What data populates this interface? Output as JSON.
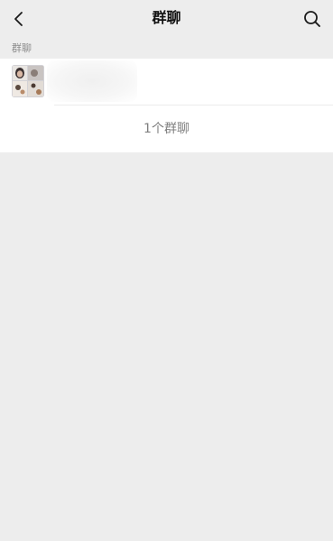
{
  "nav": {
    "title": "群聊",
    "back_icon": "chevron-left-icon",
    "search_icon": "search-icon"
  },
  "section": {
    "label": "群聊"
  },
  "groups": [
    {
      "name": "",
      "avatar": "group-avatar-image"
    }
  ],
  "footer": {
    "count_text": "1个群聊"
  },
  "colors": {
    "page_background": "#ededed",
    "card_background": "#ffffff",
    "secondary_text": "#8c8c8c"
  }
}
